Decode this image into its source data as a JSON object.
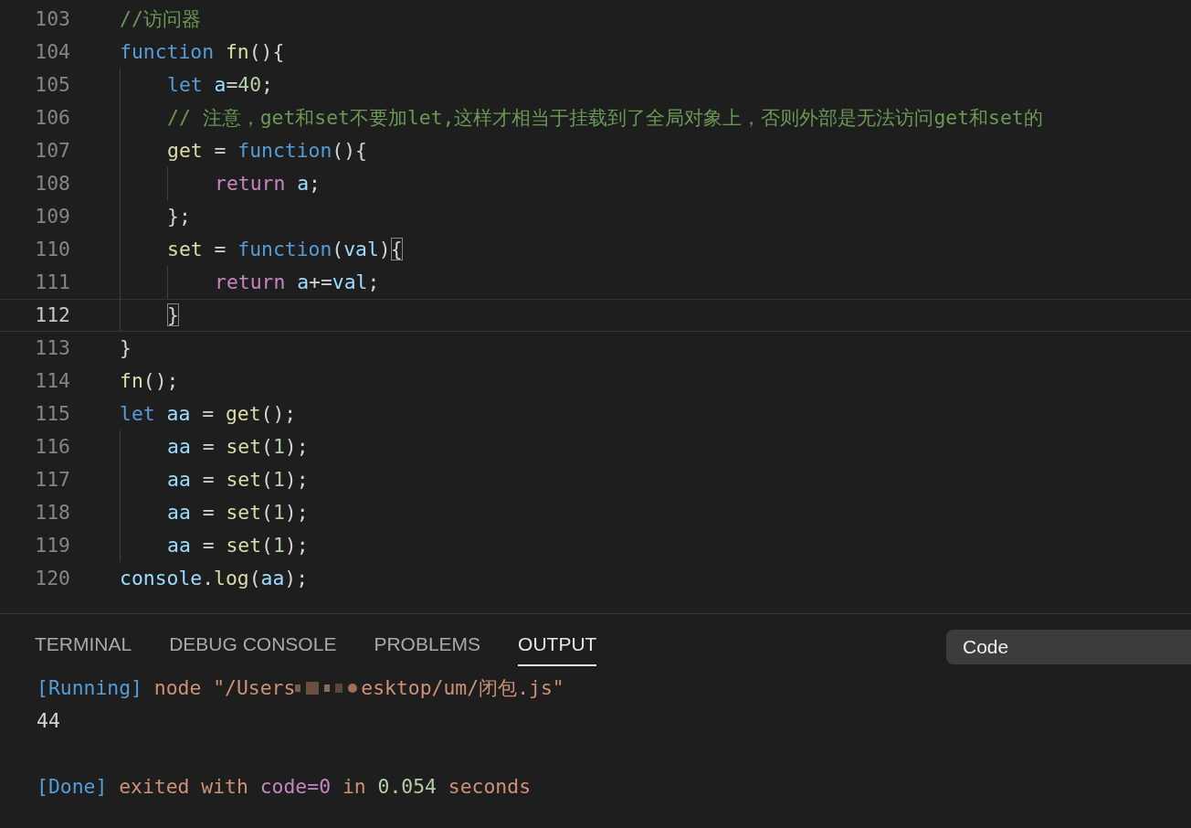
{
  "editor": {
    "lines": [
      {
        "number": "103",
        "current": false,
        "tokens": [
          {
            "kind": "comment",
            "text": "//访问器"
          }
        ]
      },
      {
        "number": "104",
        "current": false,
        "tokens": [
          {
            "kind": "keyword",
            "text": "function"
          },
          {
            "kind": "func",
            "text": " fn"
          },
          {
            "kind": "plain",
            "text": "(){"
          }
        ],
        "children": [
          {
            "number": "105",
            "current": false,
            "tokens": [
              {
                "kind": "keyword",
                "text": "let"
              },
              {
                "kind": "var",
                "text": " a"
              },
              {
                "kind": "plain",
                "text": "="
              },
              {
                "kind": "num",
                "text": "40"
              },
              {
                "kind": "plain",
                "text": ";"
              }
            ]
          },
          {
            "number": "106",
            "current": false,
            "tokens": [
              {
                "kind": "comment",
                "text": "// 注意，get和set不要加let,这样才相当于挂载到了全局对象上，否则外部是无法访问get和set的"
              }
            ]
          },
          {
            "number": "107",
            "current": false,
            "tokens": [
              {
                "kind": "func",
                "text": "get"
              },
              {
                "kind": "plain",
                "text": " = "
              },
              {
                "kind": "keyword",
                "text": "function"
              },
              {
                "kind": "plain",
                "text": "(){"
              }
            ],
            "children": [
              {
                "number": "108",
                "current": false,
                "tokens": [
                  {
                    "kind": "control",
                    "text": "return"
                  },
                  {
                    "kind": "var",
                    "text": " a"
                  },
                  {
                    "kind": "plain",
                    "text": ";"
                  }
                ]
              }
            ]
          },
          {
            "number": "109",
            "current": false,
            "tokens": [
              {
                "kind": "plain",
                "text": "};"
              }
            ]
          },
          {
            "number": "110",
            "current": false,
            "tokens": [
              {
                "kind": "func",
                "text": "set"
              },
              {
                "kind": "plain",
                "text": " = "
              },
              {
                "kind": "keyword",
                "text": "function"
              },
              {
                "kind": "plain",
                "text": "("
              },
              {
                "kind": "var",
                "text": "val"
              },
              {
                "kind": "plain",
                "text": ")"
              },
              {
                "kind": "bracket",
                "text": "{"
              }
            ],
            "children": [
              {
                "number": "111",
                "current": false,
                "tokens": [
                  {
                    "kind": "control",
                    "text": "return"
                  },
                  {
                    "kind": "var",
                    "text": " a"
                  },
                  {
                    "kind": "plain",
                    "text": "+="
                  },
                  {
                    "kind": "var",
                    "text": "val"
                  },
                  {
                    "kind": "plain",
                    "text": ";"
                  }
                ]
              }
            ]
          },
          {
            "number": "112",
            "current": true,
            "tokens": [
              {
                "kind": "bracket",
                "text": "}"
              }
            ]
          }
        ]
      },
      {
        "number": "113",
        "current": false,
        "tokens": [
          {
            "kind": "plain",
            "text": "}"
          }
        ]
      },
      {
        "number": "114",
        "current": false,
        "tokens": [
          {
            "kind": "func",
            "text": "fn"
          },
          {
            "kind": "plain",
            "text": "();"
          }
        ]
      },
      {
        "number": "115",
        "current": false,
        "tokens": [
          {
            "kind": "keyword",
            "text": "let"
          },
          {
            "kind": "var",
            "text": " aa"
          },
          {
            "kind": "plain",
            "text": " = "
          },
          {
            "kind": "func",
            "text": "get"
          },
          {
            "kind": "plain",
            "text": "();"
          }
        ],
        "children": [
          {
            "number": "116",
            "current": false,
            "tokens": [
              {
                "kind": "var",
                "text": "aa"
              },
              {
                "kind": "plain",
                "text": " = "
              },
              {
                "kind": "func",
                "text": "set"
              },
              {
                "kind": "plain",
                "text": "("
              },
              {
                "kind": "num",
                "text": "1"
              },
              {
                "kind": "plain",
                "text": ");"
              }
            ]
          },
          {
            "number": "117",
            "current": false,
            "tokens": [
              {
                "kind": "var",
                "text": "aa"
              },
              {
                "kind": "plain",
                "text": " = "
              },
              {
                "kind": "func",
                "text": "set"
              },
              {
                "kind": "plain",
                "text": "("
              },
              {
                "kind": "num",
                "text": "1"
              },
              {
                "kind": "plain",
                "text": ");"
              }
            ]
          },
          {
            "number": "118",
            "current": false,
            "tokens": [
              {
                "kind": "var",
                "text": "aa"
              },
              {
                "kind": "plain",
                "text": " = "
              },
              {
                "kind": "func",
                "text": "set"
              },
              {
                "kind": "plain",
                "text": "("
              },
              {
                "kind": "num",
                "text": "1"
              },
              {
                "kind": "plain",
                "text": ");"
              }
            ]
          },
          {
            "number": "119",
            "current": false,
            "tokens": [
              {
                "kind": "var",
                "text": "aa"
              },
              {
                "kind": "plain",
                "text": " = "
              },
              {
                "kind": "func",
                "text": "set"
              },
              {
                "kind": "plain",
                "text": "("
              },
              {
                "kind": "num",
                "text": "1"
              },
              {
                "kind": "plain",
                "text": ");"
              }
            ]
          }
        ]
      },
      {
        "number": "120",
        "current": false,
        "tokens": [
          {
            "kind": "var",
            "text": "console"
          },
          {
            "kind": "plain",
            "text": "."
          },
          {
            "kind": "func",
            "text": "log"
          },
          {
            "kind": "plain",
            "text": "("
          },
          {
            "kind": "var",
            "text": "aa"
          },
          {
            "kind": "plain",
            "text": ");"
          }
        ]
      }
    ]
  },
  "panel": {
    "tabs": [
      {
        "label": "TERMINAL",
        "selected": false
      },
      {
        "label": "DEBUG CONSOLE",
        "selected": false
      },
      {
        "label": "PROBLEMS",
        "selected": false
      },
      {
        "label": "OUTPUT",
        "selected": true
      }
    ],
    "channel_select": {
      "value": "Code"
    },
    "output": [
      {
        "kind": "running",
        "tag": "[Running]",
        "path_start": "node \"/Users",
        "path_end": "esktop/um/闭包.js\""
      },
      {
        "kind": "result",
        "text": "44"
      },
      {
        "kind": "blank"
      },
      {
        "kind": "done",
        "tag": "[Done]",
        "exited": "exited with",
        "code": "code=0",
        "in": "in",
        "time": "0.054",
        "unit": "seconds"
      }
    ]
  }
}
